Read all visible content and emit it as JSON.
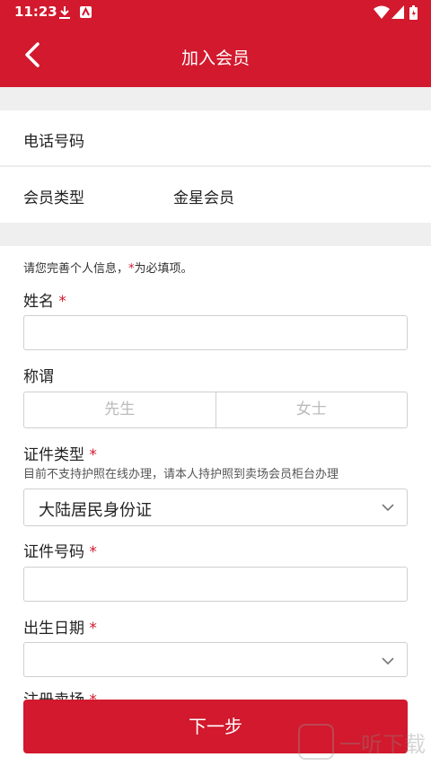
{
  "status": {
    "time": "11:23",
    "icons": [
      "download-icon",
      "app-notification-icon",
      "wifi-icon",
      "signal-icon",
      "battery-icon"
    ]
  },
  "header": {
    "title": "加入会员",
    "back_icon": "back-arrow-icon"
  },
  "info": {
    "phone_label": "电话号码",
    "type_label": "会员类型",
    "type_value": "金星会员"
  },
  "form": {
    "hint_prefix": "请您完善个人信息，",
    "hint_star": "*",
    "hint_suffix": "为必填项。",
    "name_label": "姓名",
    "title_label": "称谓",
    "title_options": [
      "先生",
      "女士"
    ],
    "id_type_label": "证件类型",
    "id_type_note": "目前不支持护照在线办理，请本人持护照到卖场会员柜台办理",
    "id_type_value": "大陆居民身份证",
    "id_number_label": "证件号码",
    "birth_label": "出生日期",
    "store_label": "注册卖场",
    "required_mark": "*"
  },
  "next_label": "下一步",
  "watermark": "一听下载",
  "colors": {
    "brand": "#d2192d",
    "bg_gray": "#efefef"
  }
}
